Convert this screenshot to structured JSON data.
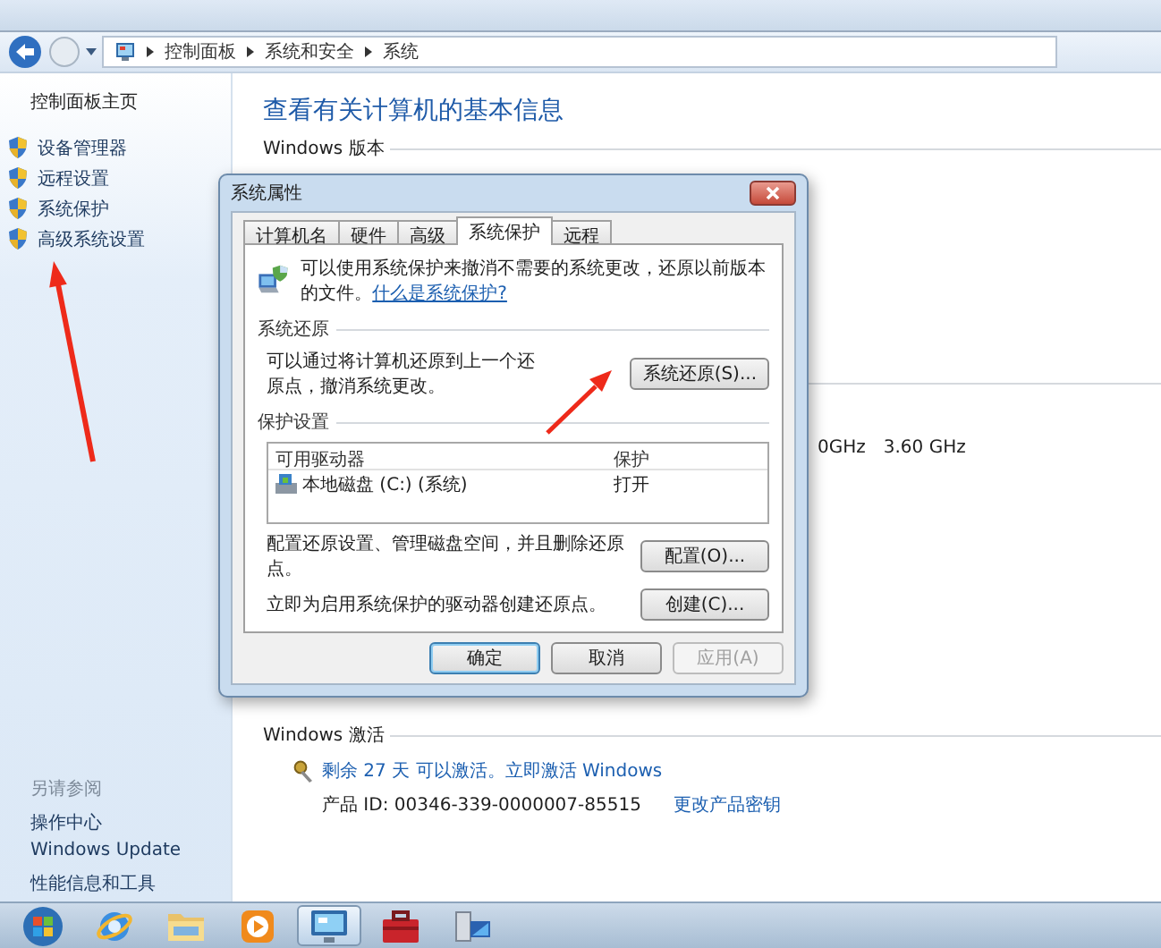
{
  "address_bar": {
    "path": [
      {
        "label": "控制面板"
      },
      {
        "label": "系统和安全"
      },
      {
        "label": "系统"
      }
    ]
  },
  "sidebar": {
    "home": "控制面板主页",
    "tasks": [
      {
        "label": "设备管理器"
      },
      {
        "label": "远程设置"
      },
      {
        "label": "系统保护"
      },
      {
        "label": "高级系统设置"
      }
    ],
    "see_also_title": "另请参阅",
    "see_also": [
      "操作中心",
      "Windows Update",
      "性能信息和工具"
    ]
  },
  "main": {
    "title": "查看有关计算机的基本信息",
    "edition_heading": "Windows 版本",
    "cpu_text": "0GHz",
    "cpu_speed": "3.60 GHz",
    "activation": {
      "heading": "Windows 激活",
      "status_link": "剩余 27 天 可以激活。立即激活 Windows",
      "product_id": "产品 ID: 00346-339-0000007-85515",
      "change_key_link": "更改产品密钥"
    }
  },
  "dialog": {
    "title": "系统属性",
    "tabs": [
      {
        "label": "计算机名",
        "selected": false
      },
      {
        "label": "硬件",
        "selected": false
      },
      {
        "label": "高级",
        "selected": false
      },
      {
        "label": "系统保护",
        "selected": true
      },
      {
        "label": "远程",
        "selected": false
      }
    ],
    "intro": "可以使用系统保护来撤消不需要的系统更改，还原以前版本的文件。",
    "intro_link": "什么是系统保护?",
    "restore_group": {
      "heading": "系统还原",
      "text": "可以通过将计算机还原到上一个还原点，撤消系统更改。",
      "button": "系统还原(S)..."
    },
    "protection_group": {
      "heading": "保护设置",
      "columns": [
        "可用驱动器",
        "保护"
      ],
      "rows": [
        {
          "drive": "本地磁盘 (C:) (系统)",
          "protection": "打开"
        }
      ],
      "actions": [
        {
          "text": "配置还原设置、管理磁盘空间，并且删除还原点。",
          "button": "配置(O)..."
        },
        {
          "text": "立即为启用系统保护的驱动器创建还原点。",
          "button": "创建(C)..."
        }
      ]
    },
    "buttons": [
      {
        "label": "确定",
        "default": true,
        "disabled": false
      },
      {
        "label": "取消",
        "default": false,
        "disabled": false
      },
      {
        "label": "应用(A)",
        "default": false,
        "disabled": true
      }
    ]
  },
  "taskbar": {
    "items": [
      {
        "kind": "start",
        "selected": false
      },
      {
        "kind": "browser",
        "selected": false
      },
      {
        "kind": "folder",
        "selected": false
      },
      {
        "kind": "media",
        "selected": false
      },
      {
        "kind": "control-panel",
        "selected": true
      },
      {
        "kind": "toolbox",
        "selected": false
      },
      {
        "kind": "computer",
        "selected": false
      }
    ]
  }
}
